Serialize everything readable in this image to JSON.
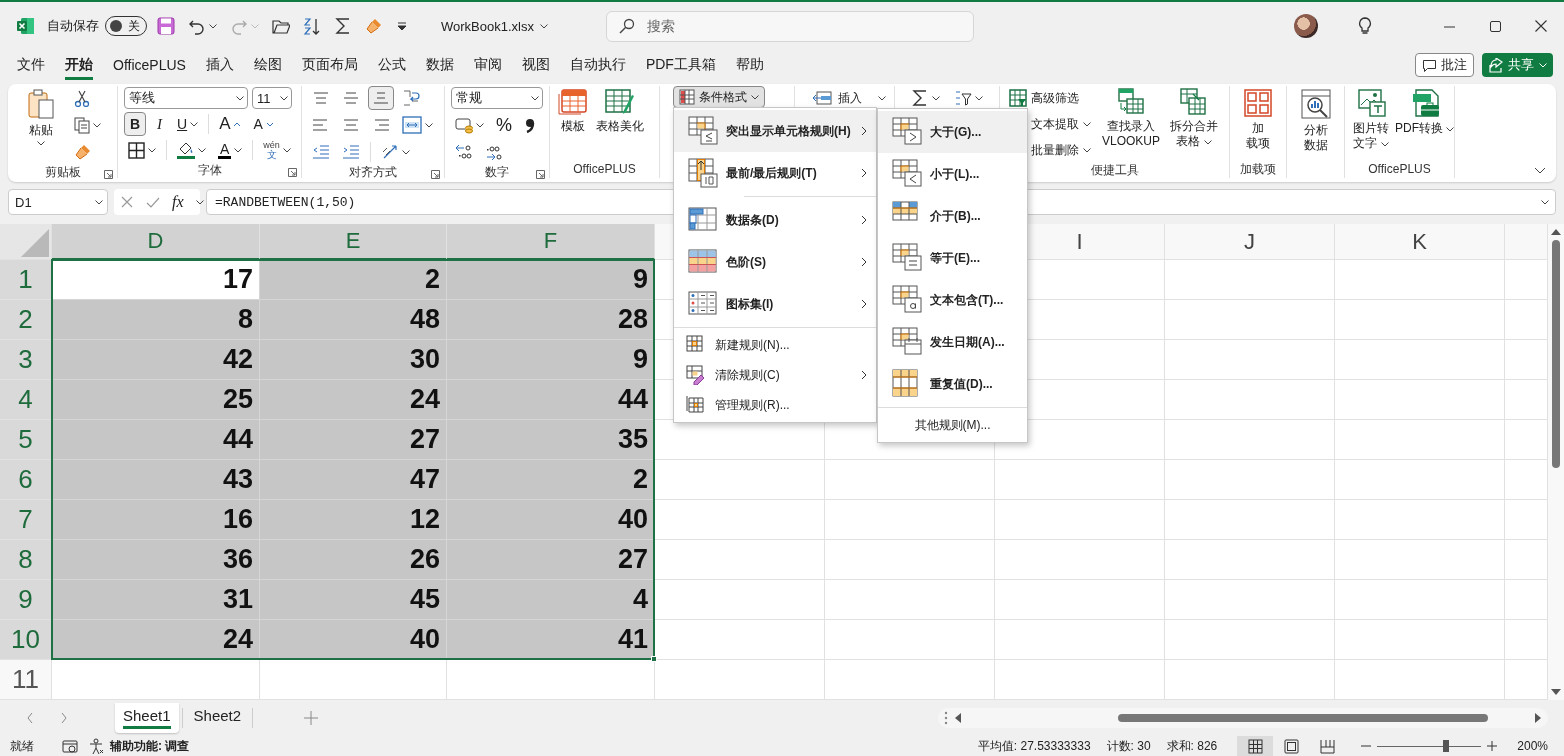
{
  "title_bar": {
    "autosave_label": "自动保存",
    "autosave_on": false,
    "autosave_state": "关",
    "filename": "WorkBook1.xlsx",
    "search": {
      "placeholder": "搜索"
    }
  },
  "menu_tabs": [
    {
      "label": "文件",
      "selected": false
    },
    {
      "label": "开始",
      "selected": true
    },
    {
      "label": "OfficePLUS",
      "selected": false
    },
    {
      "label": "插入",
      "selected": false
    },
    {
      "label": "绘图",
      "selected": false
    },
    {
      "label": "页面布局",
      "selected": false
    },
    {
      "label": "公式",
      "selected": false
    },
    {
      "label": "数据",
      "selected": false
    },
    {
      "label": "审阅",
      "selected": false
    },
    {
      "label": "视图",
      "selected": false
    },
    {
      "label": "自动执行",
      "selected": false
    },
    {
      "label": "PDF工具箱",
      "selected": false
    },
    {
      "label": "帮助",
      "selected": false
    }
  ],
  "comment_button": "批注",
  "share_button": "共享",
  "ribbon": {
    "clipboard": {
      "paste": "粘贴",
      "label": "剪贴板"
    },
    "font": {
      "name": "等线",
      "size": "11",
      "bold": "B",
      "bold_on": true,
      "italic": "I",
      "underline": "U",
      "grow": "A",
      "shrink": "A",
      "font_color": "A",
      "phonetic": "wén",
      "phonetic_char": "文",
      "label": "字体"
    },
    "alignment": {
      "bottom_align_on": true,
      "label": "对齐方式"
    },
    "number": {
      "format": "常规",
      "percent": "%",
      "label": "数字"
    },
    "officeplus": {
      "buttons": [
        "模板",
        "表格美化"
      ],
      "label": "OfficePLUS"
    },
    "conditional_format": {
      "label": "条件格式",
      "open": true
    },
    "cells": {
      "insert": "插入"
    },
    "tools": {
      "small_buttons": [
        {
          "label": "高级筛选",
          "dropdown": false
        },
        {
          "label": "文本提取",
          "dropdown": true
        },
        {
          "label": "批量删除",
          "dropdown": true
        }
      ],
      "large_buttons": [
        {
          "lines": [
            "查找录入",
            "VLOOKUP"
          ],
          "dropdown": false
        },
        {
          "lines": [
            "拆分合并",
            "表格"
          ],
          "dropdown": true
        }
      ],
      "label": "便捷工具"
    },
    "addins": {
      "lines": [
        "加",
        "载项"
      ],
      "label": "加载项"
    },
    "analyze": {
      "lines": [
        "分析",
        "数据"
      ]
    },
    "officeplus2": {
      "buttons": [
        {
          "lines": [
            "图片转",
            "文字"
          ],
          "dropdown": true
        },
        {
          "lines": [
            "PDF转换"
          ],
          "dropdown": true
        }
      ],
      "label": "OfficePLUS"
    }
  },
  "formula_bar": {
    "name_box": "D1",
    "fx": "fx",
    "formula": "=RANDBETWEEN(1,50)"
  },
  "sheet": {
    "columns": [
      {
        "kind": "header",
        "label": "D",
        "selected": true
      },
      {
        "kind": "header",
        "label": "E",
        "selected": true
      },
      {
        "kind": "header",
        "label": "F",
        "selected": true
      },
      {
        "kind": "blank"
      },
      {
        "kind": "covered"
      },
      {
        "kind": "header",
        "label": "I",
        "selected": false
      },
      {
        "kind": "header",
        "label": "J",
        "selected": false
      },
      {
        "kind": "header",
        "label": "K",
        "selected": false
      }
    ],
    "rows": [
      {
        "number": "1",
        "selected": true,
        "cells": [
          {
            "value": "17",
            "active": true
          },
          {
            "value": "2",
            "active": false
          },
          {
            "value": "9",
            "active": false
          }
        ]
      },
      {
        "number": "2",
        "selected": true,
        "cells": [
          {
            "value": "8",
            "active": false
          },
          {
            "value": "48",
            "active": false
          },
          {
            "value": "28",
            "active": false
          }
        ]
      },
      {
        "number": "3",
        "selected": true,
        "cells": [
          {
            "value": "42",
            "active": false
          },
          {
            "value": "30",
            "active": false
          },
          {
            "value": "9",
            "active": false
          }
        ]
      },
      {
        "number": "4",
        "selected": true,
        "cells": [
          {
            "value": "25",
            "active": false
          },
          {
            "value": "24",
            "active": false
          },
          {
            "value": "44",
            "active": false
          }
        ]
      },
      {
        "number": "5",
        "selected": true,
        "cells": [
          {
            "value": "44",
            "active": false
          },
          {
            "value": "27",
            "active": false
          },
          {
            "value": "35",
            "active": false
          }
        ]
      },
      {
        "number": "6",
        "selected": true,
        "cells": [
          {
            "value": "43",
            "active": false
          },
          {
            "value": "47",
            "active": false
          },
          {
            "value": "2",
            "active": false
          }
        ]
      },
      {
        "number": "7",
        "selected": true,
        "cells": [
          {
            "value": "16",
            "active": false
          },
          {
            "value": "12",
            "active": false
          },
          {
            "value": "40",
            "active": false
          }
        ]
      },
      {
        "number": "8",
        "selected": true,
        "cells": [
          {
            "value": "36",
            "active": false
          },
          {
            "value": "26",
            "active": false
          },
          {
            "value": "27",
            "active": false
          }
        ]
      },
      {
        "number": "9",
        "selected": true,
        "cells": [
          {
            "value": "31",
            "active": false
          },
          {
            "value": "45",
            "active": false
          },
          {
            "value": "4",
            "active": false
          }
        ]
      },
      {
        "number": "10",
        "selected": true,
        "cells": [
          {
            "value": "24",
            "active": false
          },
          {
            "value": "40",
            "active": false
          },
          {
            "value": "41",
            "active": false
          }
        ]
      },
      {
        "number": "11",
        "selected": false
      }
    ]
  },
  "cf_menu": {
    "items": [
      {
        "kind": "large",
        "label": "突出显示单元格规则(H)",
        "submenu": true,
        "selected": true
      },
      {
        "kind": "large",
        "label": "最前/最后规则(T)",
        "submenu": true,
        "selected": false
      },
      {
        "kind": "large",
        "label": "数据条(D)",
        "submenu": true,
        "selected": false
      },
      {
        "kind": "large",
        "label": "色阶(S)",
        "submenu": true,
        "selected": false
      },
      {
        "kind": "large",
        "label": "图标集(I)",
        "submenu": true,
        "selected": false
      },
      {
        "kind": "small",
        "label": "新建规则(N)...",
        "submenu": false,
        "selected": false
      },
      {
        "kind": "small",
        "label": "清除规则(C)",
        "submenu": true,
        "selected": false
      },
      {
        "kind": "small",
        "label": "管理规则(R)...",
        "submenu": false,
        "selected": false
      }
    ],
    "submenu": [
      {
        "label": "大于(G)...",
        "selected": true
      },
      {
        "label": "小于(L)...",
        "selected": false
      },
      {
        "label": "介于(B)...",
        "selected": false
      },
      {
        "label": "等于(E)...",
        "selected": false
      },
      {
        "label": "文本包含(T)...",
        "selected": false
      },
      {
        "label": "发生日期(A)...",
        "selected": false
      },
      {
        "label": "重复值(D)...",
        "selected": false
      }
    ],
    "submenu_more": "其他规则(M)..."
  },
  "sheet_tabs": [
    {
      "label": "Sheet1",
      "selected": true
    },
    {
      "label": "Sheet2",
      "selected": false
    }
  ],
  "status": {
    "ready": "就绪",
    "accessibility": "辅助功能: 调查",
    "average": "平均值: 27.53333333",
    "count": "计数: 30",
    "sum": "求和: 826",
    "views": [
      {
        "selected": true
      },
      {
        "selected": false
      },
      {
        "selected": false
      }
    ],
    "level": 0.66,
    "zoom": "200%"
  }
}
